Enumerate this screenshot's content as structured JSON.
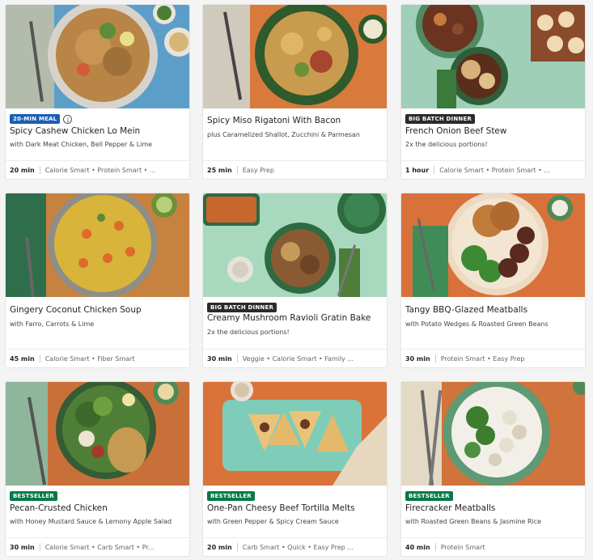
{
  "colors": {
    "badge_20min": "#1a5fb4",
    "badge_big_batch": "#2b2b2b",
    "badge_bestseller": "#067a46"
  },
  "cards": [
    {
      "badge": "20-MIN MEAL",
      "badge_color": "#1a5fb4",
      "info_icon": "i",
      "title": "Spicy Cashew Chicken Lo Mein",
      "subtitle": "with Dark Meat Chicken, Bell Pepper & Lime",
      "time": "20 min",
      "tags": "Calorie Smart • Protein Smart • ..."
    },
    {
      "badge": "",
      "title": "Spicy Miso Rigatoni With Bacon",
      "subtitle": "plus Caramelized Shallot, Zucchini & Parmesan",
      "time": "25 min",
      "tags": "Easy Prep"
    },
    {
      "badge": "BIG BATCH DINNER",
      "badge_color": "#2b2b2b",
      "title": "French Onion Beef Stew",
      "subtitle": "2x the delicious portions!",
      "time": "1 hour",
      "tags": "Calorie Smart • Protein Smart • ..."
    },
    {
      "badge": "",
      "title": "Gingery Coconut Chicken Soup",
      "subtitle": "with Farro, Carrots & Lime",
      "time": "45 min",
      "tags": "Calorie Smart • Fiber Smart"
    },
    {
      "badge": "BIG BATCH DINNER",
      "badge_color": "#2b2b2b",
      "title": "Creamy Mushroom Ravioli Gratin Bake",
      "subtitle": "2x the delicious portions!",
      "time": "30 min",
      "tags": "Veggie • Calorie Smart • Family ..."
    },
    {
      "badge": "",
      "title": "Tangy BBQ-Glazed Meatballs",
      "subtitle": "with Potato Wedges & Roasted Green Beans",
      "time": "30 min",
      "tags": "Protein Smart • Easy Prep"
    },
    {
      "badge": "BESTSELLER",
      "badge_color": "#067a46",
      "title": "Pecan-Crusted Chicken",
      "subtitle": "with Honey Mustard Sauce & Lemony Apple Salad",
      "time": "30 min",
      "tags": "Calorie Smart • Carb Smart • Pr..."
    },
    {
      "badge": "BESTSELLER",
      "badge_color": "#067a46",
      "title": "One-Pan Cheesy Beef Tortilla Melts",
      "subtitle": "with Green Pepper & Spicy Cream Sauce",
      "time": "20 min",
      "tags": "Carb Smart • Quick • Easy Prep ..."
    },
    {
      "badge": "BESTSELLER",
      "badge_color": "#067a46",
      "title": "Firecracker Meatballs",
      "subtitle": "with Roasted Green Beans & Jasmine Rice",
      "time": "40 min",
      "tags": "Protein Smart"
    }
  ]
}
